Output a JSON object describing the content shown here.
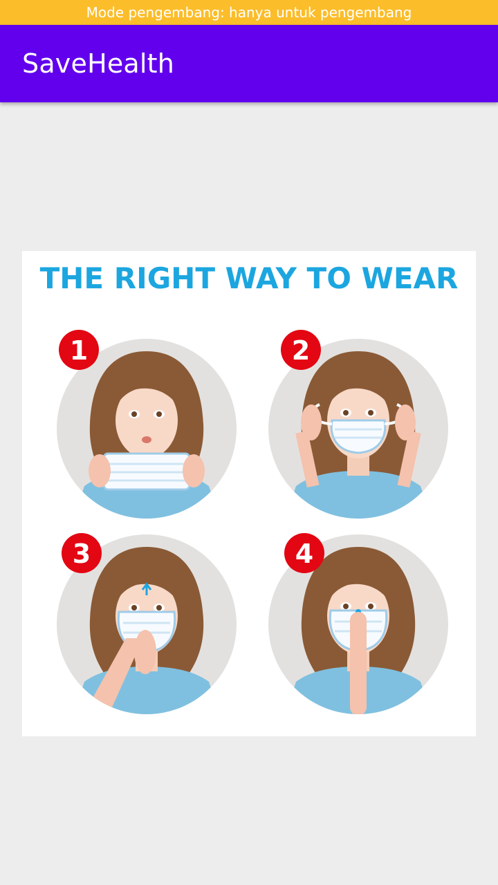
{
  "status_banner": "Mode pengembang: hanya untuk pengembang",
  "app_bar": {
    "title": "SaveHealth"
  },
  "infographic": {
    "heading": "THE RIGHT WAY TO WEAR",
    "steps": [
      {
        "number": "1",
        "icon": "hold-mask-illustration"
      },
      {
        "number": "2",
        "icon": "loop-ear-straps-illustration"
      },
      {
        "number": "3",
        "icon": "pull-mask-down-illustration"
      },
      {
        "number": "4",
        "icon": "press-nose-wire-illustration"
      }
    ]
  },
  "colors": {
    "status_banner": "#fbbd2a",
    "app_bar": "#6200ee",
    "background": "#ededed",
    "heading_blue": "#1ca6e0",
    "step_badge_red": "#e30613"
  }
}
